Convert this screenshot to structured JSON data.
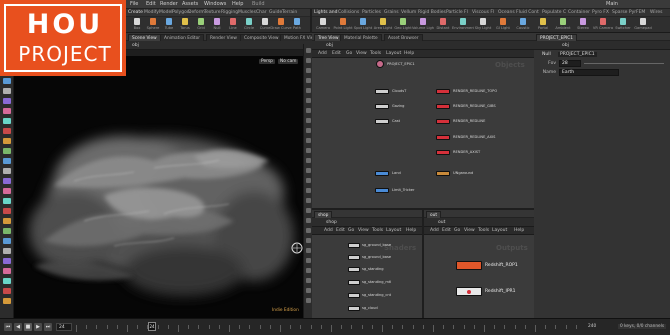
{
  "app": {
    "menubar": [
      "File",
      "Edit",
      "Render",
      "Assets",
      "Windows",
      "Help"
    ],
    "desktop": "Build",
    "search_label": "Main",
    "version": "Houdini FX"
  },
  "shelf_left": {
    "tabs": [
      "Create",
      "Modify",
      "Model",
      "Polygon",
      "Deform",
      "Texture",
      "Rigging",
      "Muscles",
      "Char",
      "Guide",
      "Terrain",
      "Crowds"
    ],
    "tools": [
      "Box",
      "Sphere",
      "Tube",
      "Torus",
      "Grid",
      "Null",
      "Line",
      "Circle",
      "Curve",
      "Draw Curve",
      "Path",
      "Spray Paint",
      "Font",
      "Platonic",
      "L-System",
      "Metaball",
      "File"
    ]
  },
  "shelf_right": {
    "tabs": [
      "Lights and",
      "Collisions",
      "Particles",
      "Grains",
      "Vellum",
      "Rigid Bodies",
      "Particle Fl",
      "Viscous Fl",
      "Oceans",
      "Fluid Cont",
      "Populate C",
      "Container",
      "Pyro FX",
      "Sparse Pyr",
      "FEM",
      "Wires",
      "Crowds",
      "Drive Sim"
    ],
    "tools": [
      "Camera",
      "Point Light",
      "Spot Light",
      "Area Light",
      "Geo Light",
      "Volume Light",
      "Distant",
      "Environment",
      "Sky Light",
      "GI Light",
      "Caustic",
      "Portal",
      "Ambient",
      "Stereo",
      "VR Camera",
      "Switcher",
      "Gamepad"
    ]
  },
  "viewport": {
    "tabs": [
      "Scene View",
      "Animation Editor",
      "Render View",
      "Composite View",
      "Motion FX View",
      "Geometry Spreadsheet"
    ],
    "path": "obj",
    "persp": "Persp",
    "cam": "No cam",
    "status": "Indie Edition"
  },
  "network_top": {
    "tabs": [
      "Tree View",
      "Material Palette",
      "Asset Browser"
    ],
    "path": "obj",
    "menu": [
      "Add",
      "Edit",
      "Go",
      "View",
      "Tools",
      "Layout",
      "Help"
    ],
    "watermark": "Objects",
    "nodes_left": [
      {
        "label": "PROJECT_EPIC1",
        "color": "#c66a8a"
      },
      {
        "label": "CloudsT",
        "color": "#cfcfcf"
      },
      {
        "label": "Gazing",
        "color": "#cfcfcf"
      },
      {
        "label": "Cast",
        "color": "#cfcfcf"
      },
      {
        "label": "Land",
        "color": "#4a8bd6"
      },
      {
        "label": "Limit_Tricker",
        "color": "#4a8bd6"
      }
    ],
    "nodes_right": [
      {
        "label": "RENDER_REDLINE_TOPO",
        "color": "#d5303a"
      },
      {
        "label": "RENDER_REDLINE_GIBS",
        "color": "#d5303a"
      },
      {
        "label": "RENDER_REDLINE",
        "color": "#d5303a"
      },
      {
        "label": "RENDER_REDLINE_AXIS",
        "color": "#d5303a"
      },
      {
        "label": "RENDER_AXIST",
        "color": "#d5303a"
      },
      {
        "label": "UNgaround",
        "color": "#c98a3a"
      }
    ]
  },
  "network_shop": {
    "tab": "shop",
    "path": "shop",
    "menu": [
      "Add",
      "Edit",
      "Go",
      "View",
      "Tools",
      "Layout",
      "Help"
    ],
    "watermark": "Shaders",
    "nodes": [
      "sg_ground_base",
      "sg_ground_base",
      "sg_standing",
      "sg_standing_mtl",
      "sg_standing_cnt",
      "sg_cloud"
    ]
  },
  "network_out": {
    "tab": "out",
    "path": "out",
    "menu": [
      "Add",
      "Edit",
      "Go",
      "View",
      "Tools",
      "Layout",
      "Help"
    ],
    "watermark": "Outputs",
    "nodes": [
      {
        "label": "Redshift_ROP1",
        "color": "#e0572a"
      },
      {
        "label": "Redshift_IPR1",
        "color": "#e8e8e8"
      }
    ]
  },
  "params": {
    "tab": "PROJECT_EPIC1",
    "path": "obj",
    "node_type": "Null",
    "node_name": "PROJECT_EPIC1",
    "rows": [
      {
        "label": "Fov",
        "value": "28"
      },
      {
        "label": "Name",
        "value": "Earth"
      }
    ]
  },
  "timeline": {
    "current_frame": "24",
    "start": "1",
    "end": "240",
    "marker": "24",
    "keys": "0 keys, 0/0 channels",
    "status": "Auto Update"
  },
  "logo": {
    "line1": "HOU",
    "line2": "PROJECT"
  },
  "colors": {
    "accent": "#e8501e",
    "render_node": "#d5303a",
    "light_node": "#4a8bd6"
  }
}
